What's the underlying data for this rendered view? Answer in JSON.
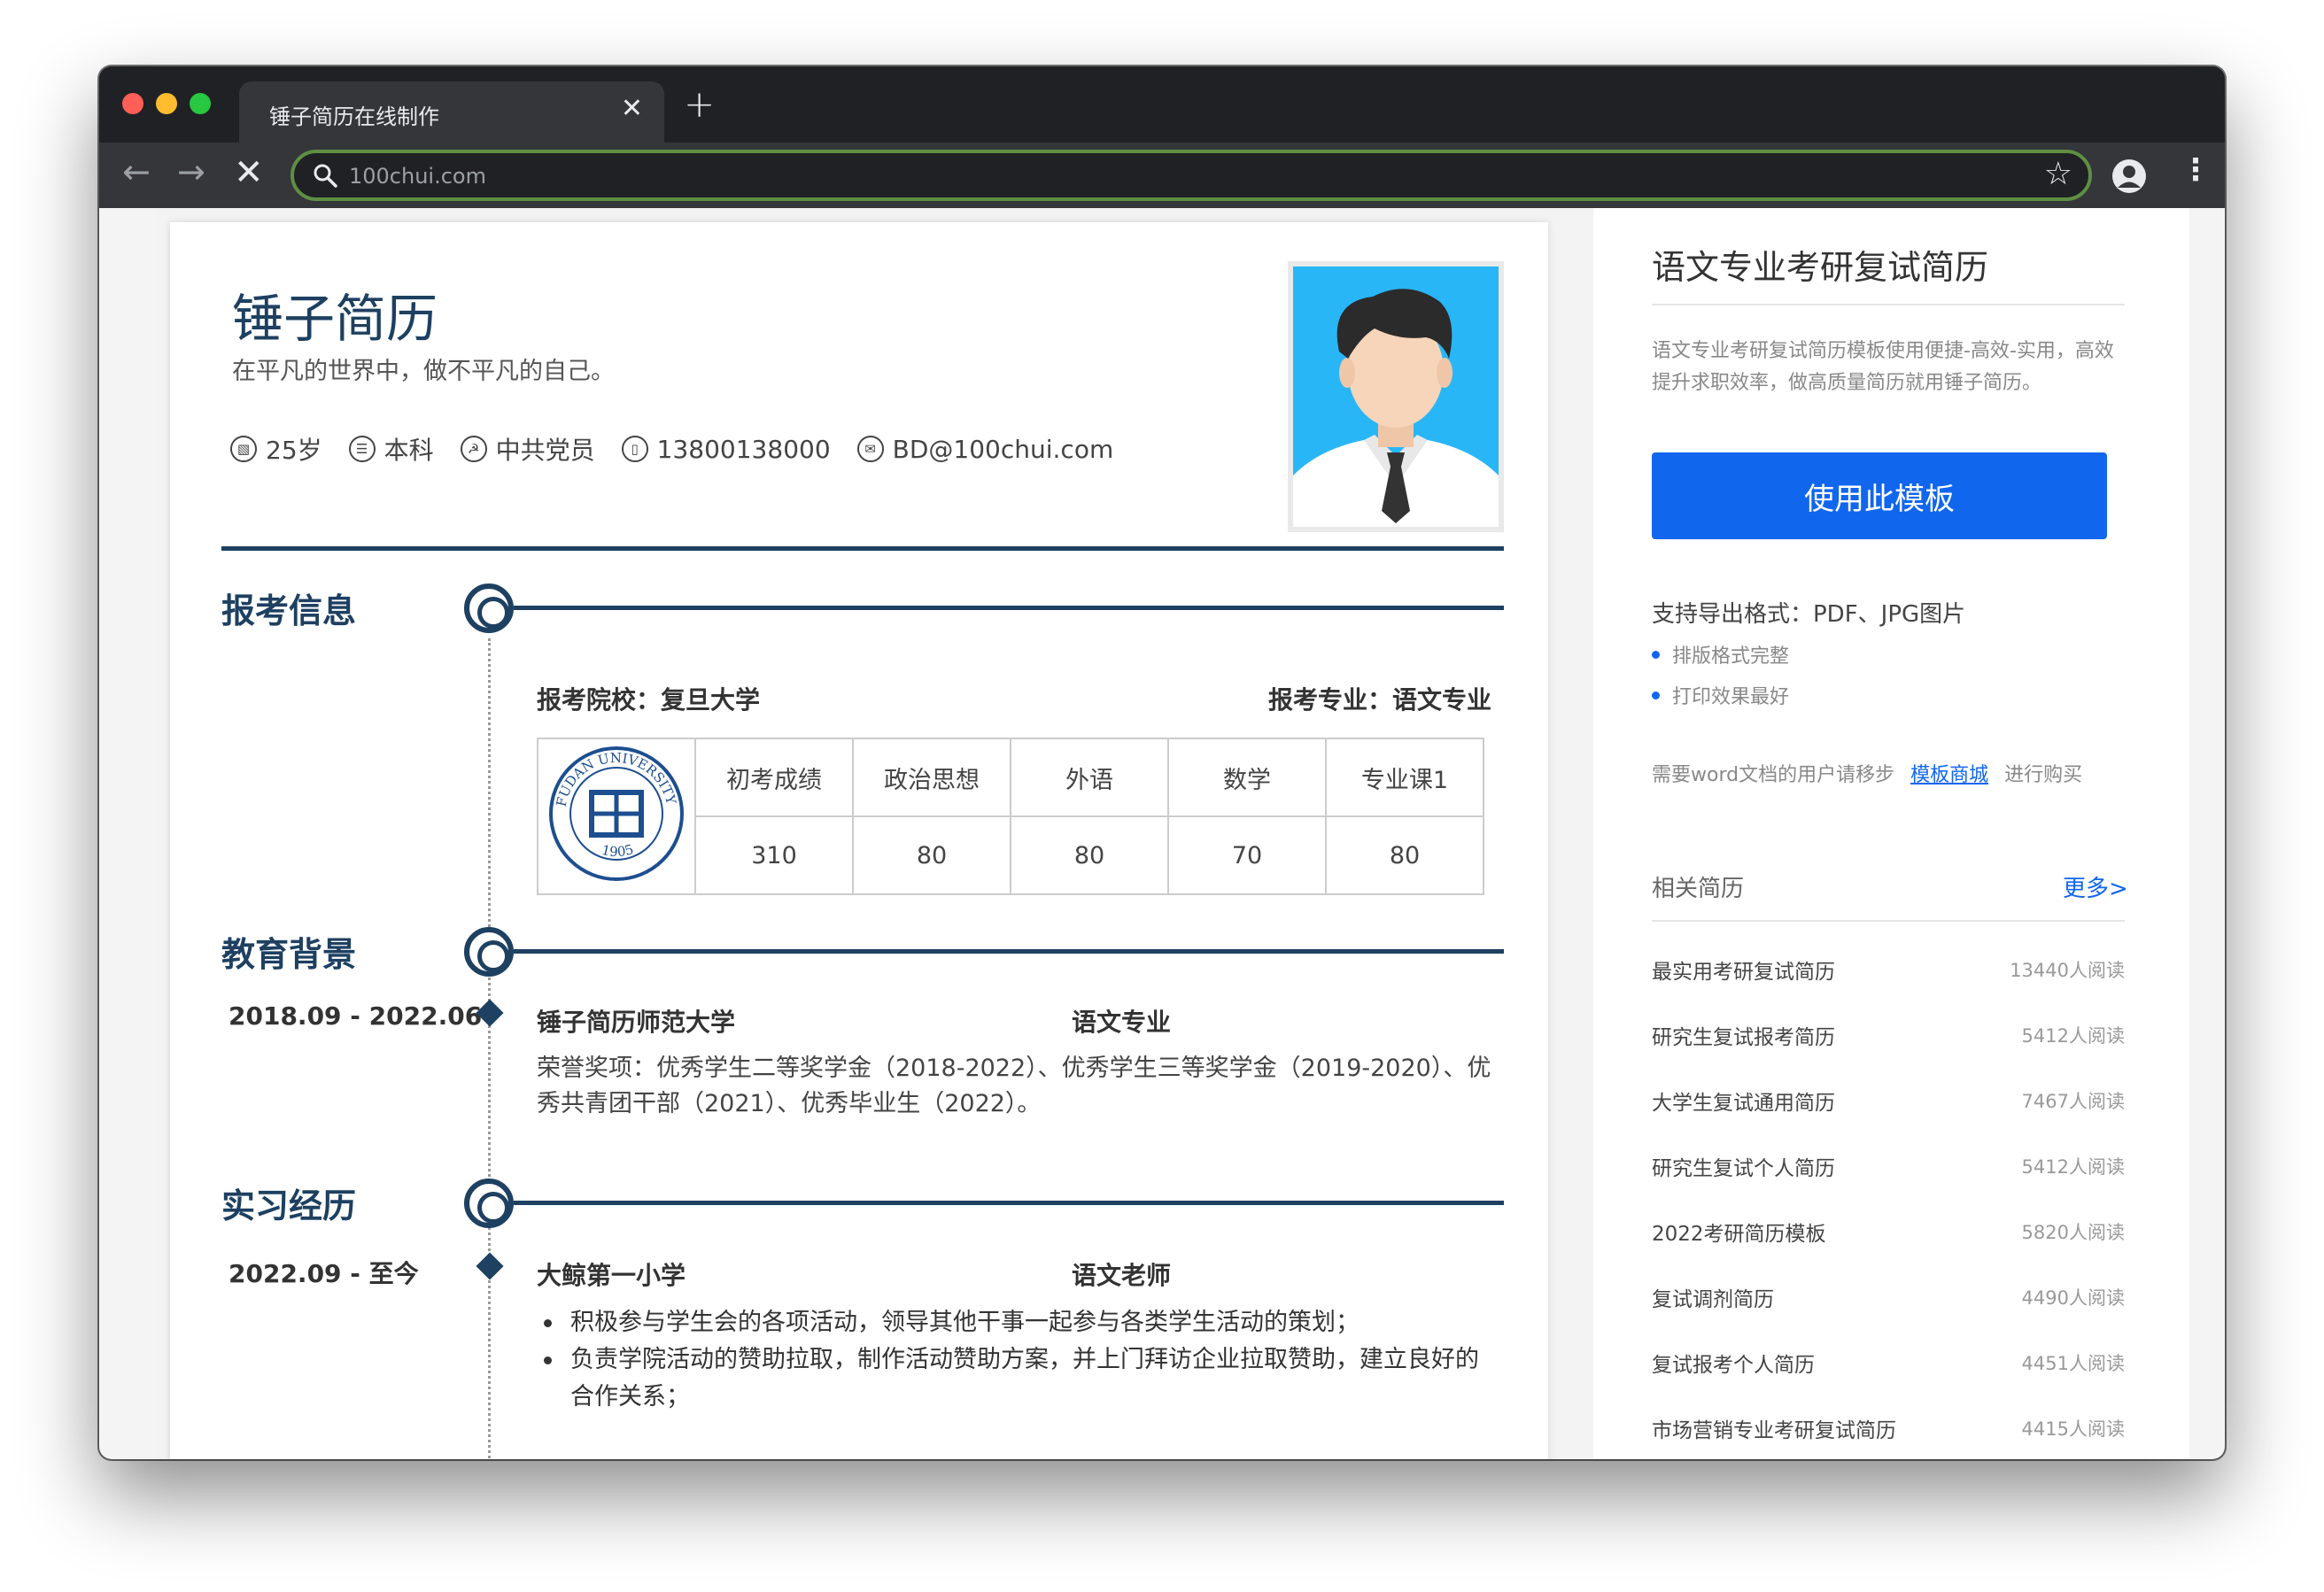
{
  "browser": {
    "tab_title": "锤子简历在线制作",
    "tab_close": "✕",
    "new_tab": "+",
    "url": "100chui.com"
  },
  "resume": {
    "name": "锤子简历",
    "motto": "在平凡的世界中，做不平凡的自己。",
    "info": [
      {
        "icon": "chart-icon",
        "text": "25岁"
      },
      {
        "icon": "degree-icon",
        "text": "本科"
      },
      {
        "icon": "party-icon",
        "text": "中共党员"
      },
      {
        "icon": "phone-icon",
        "text": "13800138000"
      },
      {
        "icon": "mail-icon",
        "text": "BD@100chui.com"
      }
    ],
    "sections": {
      "exam": {
        "title": "报考信息",
        "school": "报考院校：复旦大学",
        "major": "报考专业：语文专业",
        "logo_text": "FUDAN UNIVERSITY",
        "logo_year": "1905",
        "headers": [
          "初考成绩",
          "政治思想",
          "外语",
          "数学",
          "专业课1"
        ],
        "scores": [
          "310",
          "80",
          "80",
          "70",
          "80"
        ]
      },
      "education": {
        "title": "教育背景",
        "date": "2018.09 - 2022.06",
        "school": "锤子简历师范大学",
        "major": "语文专业",
        "honors": "荣誉奖项：优秀学生二等奖学金（2018-2022）、优秀学生三等奖学金（2019-2020）、优秀共青团干部（2021）、优秀毕业生（2022）。"
      },
      "internship": {
        "title": "实习经历",
        "date": "2022.09 - 至今",
        "org": "大鲸第一小学",
        "role": "语文老师",
        "bullets": [
          "积极参与学生会的各项活动，领导其他干事一起参与各类学生活动的策划；",
          "负责学院活动的赞助拉取，制作活动赞助方案，并上门拜访企业拉取赞助，建立良好的合作关系；"
        ]
      }
    }
  },
  "sidebar": {
    "title": "语文专业考研复试简历",
    "desc": "语文专业考研复试简历模板使用便捷-高效-实用，高效提升求职效率，做高质量简历就用锤子简历。",
    "use_button": "使用此模板",
    "formats": "支持导出格式：PDF、JPG图片",
    "features": [
      "排版格式完整",
      "打印效果最好"
    ],
    "note_prefix": "需要word文档的用户请移步",
    "note_link": "模板商城",
    "note_suffix": "进行购买",
    "related_title": "相关简历",
    "more": "更多>",
    "related": [
      {
        "name": "最实用考研复试简历",
        "count": "13440人阅读"
      },
      {
        "name": "研究生复试报考简历",
        "count": "5412人阅读"
      },
      {
        "name": "大学生复试通用简历",
        "count": "7467人阅读"
      },
      {
        "name": "研究生复试个人简历",
        "count": "5412人阅读"
      },
      {
        "name": "2022考研简历模板",
        "count": "5820人阅读"
      },
      {
        "name": "复试调剂简历",
        "count": "4490人阅读"
      },
      {
        "name": "复试报考个人简历",
        "count": "4451人阅读"
      },
      {
        "name": "市场营销专业考研复试简历",
        "count": "4415人阅读"
      }
    ]
  },
  "colors": {
    "accent": "#1e4061",
    "button": "#1166ee",
    "photo_bg": "#29b6f6"
  }
}
